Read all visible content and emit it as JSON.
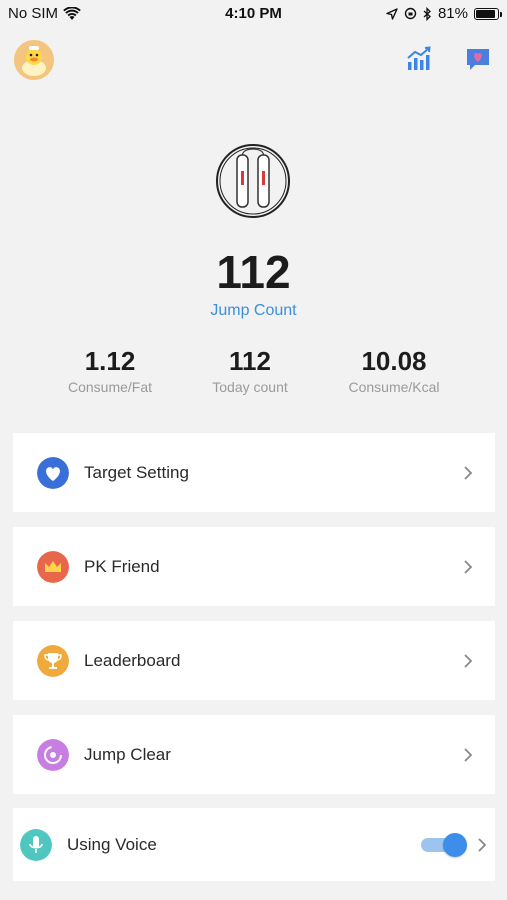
{
  "status_bar": {
    "carrier": "No SIM",
    "time": "4:10 PM",
    "battery_percent": "81%",
    "battery_level": 0.81
  },
  "header": {
    "avatar_icon": "duck-avatar-icon",
    "stats_icon": "bar-chart-trend-icon",
    "message_icon": "heart-message-icon"
  },
  "hero": {
    "count": "112",
    "count_label": "Jump Count"
  },
  "stats": [
    {
      "value": "1.12",
      "label": "Consume/Fat"
    },
    {
      "value": "112",
      "label": "Today count"
    },
    {
      "value": "10.08",
      "label": "Consume/Kcal"
    }
  ],
  "menu": [
    {
      "label": "Target Setting",
      "icon": "heart-icon",
      "color": "#3a6fd8"
    },
    {
      "label": "PK Friend",
      "icon": "crown-icon",
      "color": "#e8674a"
    },
    {
      "label": "Leaderboard",
      "icon": "trophy-icon",
      "color": "#f0a93c"
    },
    {
      "label": "Jump Clear",
      "icon": "target-clear-icon",
      "color": "#c77ee3"
    }
  ],
  "voice": {
    "label": "Using Voice",
    "icon": "microphone-icon",
    "color": "#4fc7c0",
    "enabled": true
  },
  "colors": {
    "accent_blue": "#3b8fd9",
    "background": "#f2f2f2"
  }
}
